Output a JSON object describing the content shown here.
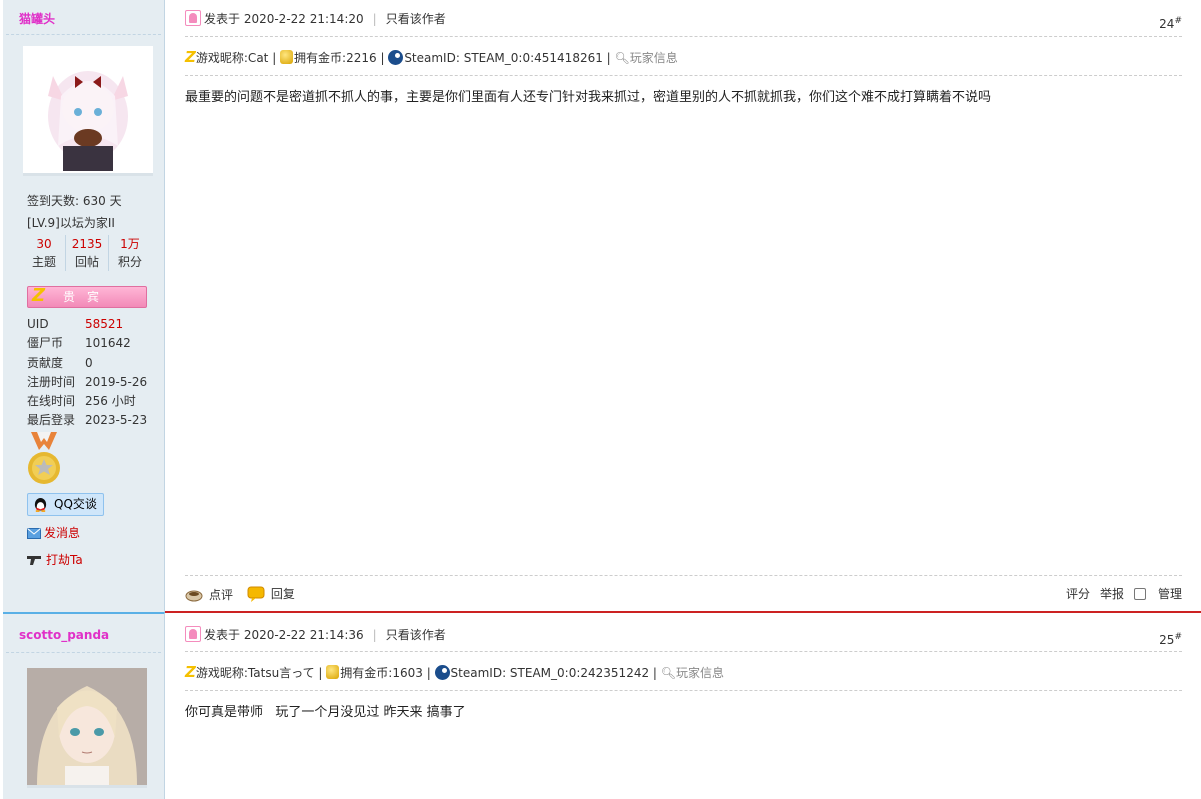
{
  "posts": [
    {
      "username": "猫罐头",
      "signin": "签到天数: 630 天",
      "level": "[LV.9]以坛为家II",
      "stats": [
        {
          "num": "30",
          "label": "主题"
        },
        {
          "num": "2135",
          "label": "回帖"
        },
        {
          "num": "1万",
          "label": "积分"
        }
      ],
      "vip_label": "贵宾",
      "info": [
        {
          "k": "UID",
          "v": "58521"
        },
        {
          "k": "僵尸币",
          "v": "101642"
        },
        {
          "k": "贡献度",
          "v": "0"
        },
        {
          "k": "注册时间",
          "v": "2019-5-26"
        },
        {
          "k": "在线时间",
          "v": "256 小时"
        },
        {
          "k": "最后登录",
          "v": "2023-5-23"
        }
      ],
      "qq_label": "QQ交谈",
      "message_label": "发消息",
      "rob_label": "打劫Ta",
      "posted_at": "发表于 2020-2-22 21:14:20",
      "only_author": "只看该作者",
      "floor": "24",
      "floor_mark": "#",
      "game_nick": "游戏昵称:Cat",
      "gold": "拥有金币:2216",
      "steam_id": "SteamID: STEAM_0:0:451418261",
      "player_info": "玩家信息",
      "content": "最重要的问题不是密道抓不抓人的事，主要是你们里面有人还专门针对我来抓过，密道里别的人不抓就抓我，你们这个难不成打算瞒着不说吗",
      "comment_label": "点评",
      "reply_label": "回复",
      "rate_label": "评分",
      "report_label": "举报",
      "manage_label": "管理"
    },
    {
      "username": "scotto_panda",
      "posted_at": "发表于 2020-2-22 21:14:36",
      "only_author": "只看该作者",
      "floor": "25",
      "floor_mark": "#",
      "game_nick": "游戏昵称:Tatsu言って",
      "gold": "拥有金币:1603",
      "steam_id": "SteamID: STEAM_0:0:242351242",
      "player_info": "玩家信息",
      "content": "你可真是带师   玩了一个月没见过 昨天来 搞事了"
    }
  ],
  "icons": [
    "post-icon",
    "z-logo-icon",
    "coin-icon",
    "steam-icon",
    "magnifier-icon",
    "comment-icon",
    "reply-icon",
    "qq-penguin-icon",
    "mail-icon",
    "gun-icon",
    "medal-icon"
  ],
  "colors": {
    "username": "#e030c8",
    "sidebar_bg": "#e5edf2",
    "red": "#cc0000",
    "separator": "#cc2222",
    "vip_pink": "#f28ab8"
  }
}
